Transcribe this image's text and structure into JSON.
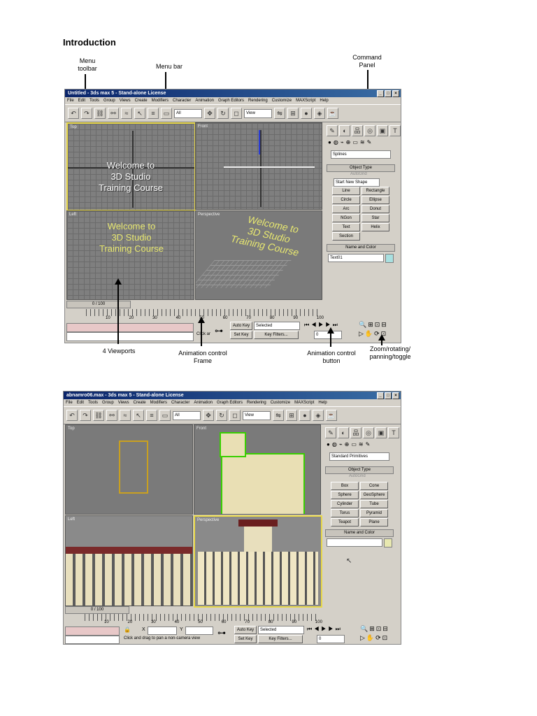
{
  "heading": "Introduction",
  "callouts": {
    "menu_toolbar": "Menu\ntoolbar",
    "menu_bar": "Menu bar",
    "command_panel": "Command\nPanel",
    "viewports": "4 Viewports",
    "animation_frame": "Animation control\nFrame",
    "animation_button": "Animation control\nbutton",
    "zoom": "Zoom/rotating/\npanning/toggle"
  },
  "shot1": {
    "title": "Untitled - 3ds max 5 - Stand-alone License",
    "menus": [
      "File",
      "Edit",
      "Tools",
      "Group",
      "Views",
      "Create",
      "Modifiers",
      "Character",
      "Animation",
      "Graph Editors",
      "Rendering",
      "Customize",
      "MAXScript",
      "Help"
    ],
    "selection_filter": "All",
    "view_dropdown": "View",
    "viewports": [
      "Top",
      "Front",
      "Left",
      "Perspective"
    ],
    "welcome_text": "Welcome to\n3D Studio\nTraining Course",
    "category_dropdown": "Splines",
    "rollout_object_type": "Object Type",
    "autogrid": "AutoGrid",
    "start_new_shape": "Start New Shape",
    "buttons": [
      "Line",
      "Rectangle",
      "Circle",
      "Ellipse",
      "Arc",
      "Donut",
      "NGon",
      "Star",
      "Text",
      "Helix",
      "Section"
    ],
    "rollout_name_color": "Name and Color",
    "object_name": "Text01",
    "frame_counter": "0 / 100",
    "ticks": [
      "10",
      "20",
      "30",
      "40",
      "50",
      "60",
      "70",
      "80",
      "90",
      "100"
    ],
    "auto_key": "Auto Key",
    "set_key": "Set Key",
    "selected": "Selected",
    "key_filters": "Key Filters...",
    "frame_value": "0",
    "status": "Click ar"
  },
  "shot2": {
    "title": "abnamro06.max - 3ds max 5 - Stand-alone License",
    "menus": [
      "File",
      "Edit",
      "Tools",
      "Group",
      "Views",
      "Create",
      "Modifiers",
      "Character",
      "Animation",
      "Graph Editors",
      "Rendering",
      "Customize",
      "MAXScript",
      "Help"
    ],
    "selection_filter": "All",
    "view_dropdown": "View",
    "viewports": [
      "Top",
      "Front",
      "Left",
      "Perspective"
    ],
    "category_dropdown": "Standard Primitives",
    "rollout_object_type": "Object Type",
    "autogrid": "AutoGrid",
    "buttons": [
      "Box",
      "Cone",
      "Sphere",
      "GeoSphere",
      "Cylinder",
      "Tube",
      "Torus",
      "Pyramid",
      "Teapot",
      "Plane"
    ],
    "rollout_name_color": "Name and Color",
    "frame_counter": "0 / 100",
    "ticks": [
      "10",
      "20",
      "30",
      "40",
      "50",
      "60",
      "70",
      "80",
      "90",
      "100"
    ],
    "x_label": "X",
    "y_label": "Y",
    "auto_key": "Auto Key",
    "set_key": "Set Key",
    "selected": "Selected",
    "key_filters": "Key Filters...",
    "frame_value": "0",
    "status": "Click and drag to pan a non-camera view"
  }
}
